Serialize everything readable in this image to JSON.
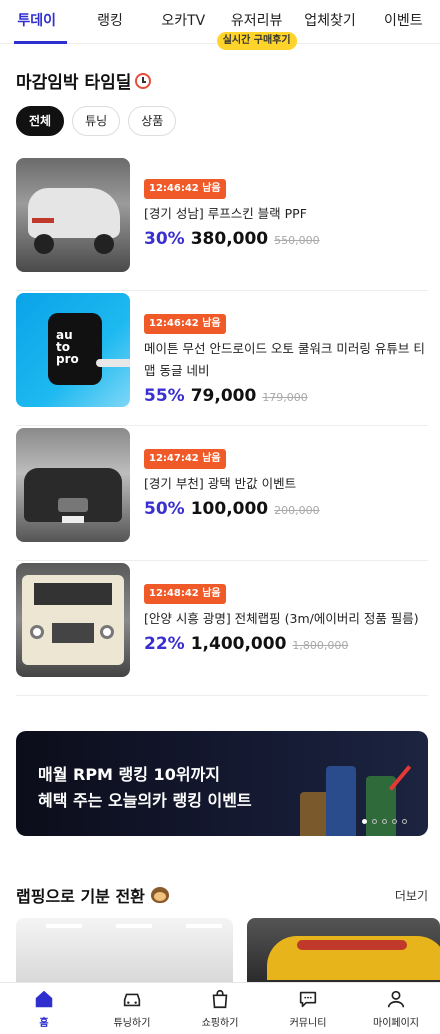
{
  "top_nav": {
    "tabs": [
      {
        "label": "투데이",
        "active": true
      },
      {
        "label": "랭킹"
      },
      {
        "label": "오카TV"
      },
      {
        "label": "유저리뷰",
        "badge": "실시간 구매후기"
      },
      {
        "label": "업체찾기"
      },
      {
        "label": "이벤트"
      }
    ]
  },
  "deadline": {
    "title": "마감임박 타임딜",
    "title_icon": "alarm-clock-icon",
    "chips": [
      {
        "label": "전체",
        "active": true
      },
      {
        "label": "튜닝"
      },
      {
        "label": "상품"
      }
    ],
    "items": [
      {
        "timer": "12:46:42 남음",
        "name": "[경기 성남] 루프스킨 블랙 PPF",
        "discount": "30%",
        "price": "380,000",
        "original": "550,000"
      },
      {
        "timer": "12:46:42 남음",
        "name": "메이튼 무선 안드로이드 오토 쿨워크 미러링 유튜브 티맵 동글 네비",
        "discount": "55%",
        "price": "79,000",
        "original": "179,000"
      },
      {
        "timer": "12:47:42 남음",
        "name": "[경기 부천] 광택 반값 이벤트",
        "discount": "50%",
        "price": "100,000",
        "original": "200,000"
      },
      {
        "timer": "12:48:42 남음",
        "name": "[안양 시흥 광명] 전체랩핑 (3m/에이버리 정품 필름)",
        "discount": "22%",
        "price": "1,400,000",
        "original": "1,800,000"
      }
    ]
  },
  "banner": {
    "line1": "매월 RPM 랭킹 10위까지",
    "line2": "혜택 주는 오늘의카 랭킹 이벤트",
    "slide_count": 5,
    "active_slide": 1
  },
  "wrapping": {
    "title": "랩핑으로 기분 전환",
    "title_icon": "monkey-face-icon",
    "more": "더보기"
  },
  "bottom_nav": [
    {
      "label": "홈",
      "icon": "home-icon",
      "active": true
    },
    {
      "label": "튜닝하기",
      "icon": "car-icon"
    },
    {
      "label": "쇼핑하기",
      "icon": "shopping-bag-icon"
    },
    {
      "label": "커뮤니티",
      "icon": "chat-bubble-icon"
    },
    {
      "label": "마이페이지",
      "icon": "user-icon"
    }
  ],
  "colors": {
    "accent": "#2f2fd0",
    "timer": "#f05a28",
    "badge": "#ffd42a"
  }
}
